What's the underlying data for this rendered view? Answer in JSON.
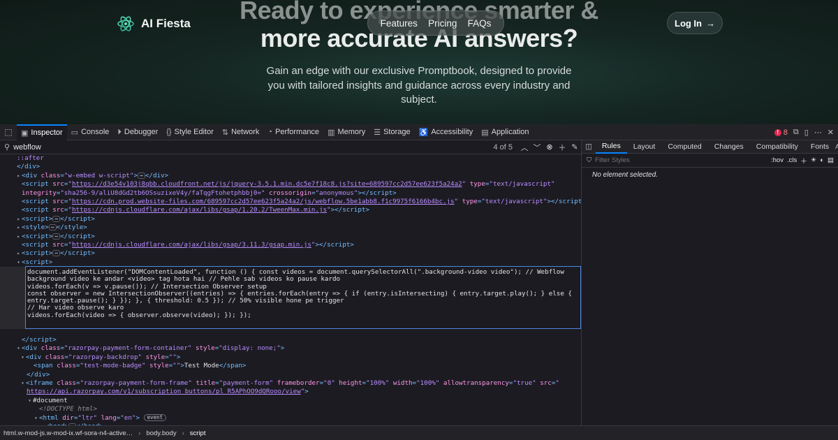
{
  "site": {
    "brand": "AI Fiesta",
    "nav": [
      "Features",
      "Pricing",
      "FAQs"
    ],
    "login_label": "Log In",
    "hero_line1": "Ready to experience smarter &",
    "hero_line2": "more accurate AI answers?",
    "hero_sub": "Gain an edge with our exclusive Promptbook, designed to provide you with tailored insights and guidance across every industry and subject."
  },
  "devtools": {
    "tabs": [
      {
        "label": "Inspector",
        "icon": "inspector-icon"
      },
      {
        "label": "Console",
        "icon": "console-icon"
      },
      {
        "label": "Debugger",
        "icon": "debugger-icon"
      },
      {
        "label": "Style Editor",
        "icon": "style-editor-icon"
      },
      {
        "label": "Network",
        "icon": "network-icon"
      },
      {
        "label": "Performance",
        "icon": "performance-icon"
      },
      {
        "label": "Memory",
        "icon": "memory-icon"
      },
      {
        "label": "Storage",
        "icon": "storage-icon"
      },
      {
        "label": "Accessibility",
        "icon": "accessibility-icon"
      },
      {
        "label": "Application",
        "icon": "application-icon"
      }
    ],
    "error_count": "8",
    "search": {
      "query": "webflow",
      "count": "4 of 5"
    },
    "markup": {
      "after": "::after",
      "close_div": "</div>",
      "embed_class": "w-embed w-script",
      "script1_src": "https://d3e54v103j8qbb.cloudfront.net/js/jquery-3.5.1.min.dc5e7f18c8.js?site=689597cc2d57ee623f5a24a2",
      "script1_type": "text/javascript",
      "script1_integrity": "sha256-9/aliU8dGd2tb6OSsuzixeV4y/faTqgFtohetphbbj0=",
      "script1_crossorigin": "anonymous",
      "script2_src": "https://cdn.prod.website-files.com/689597cc2d57ee623f5a24a2/js/webflow.5be1abb8.f1c9975f6166b4bc.js",
      "script2_type": "text/javascript",
      "script3_src": "https://cdnjs.cloudflare.com/ajax/libs/gsap/1.20.2/TweenMax.min.js",
      "script4_src": "https://cdnjs.cloudflare.com/ajax/libs/gsap/3.11.3/gsap.min.js",
      "script_body": "document.addEventListener(\"DOMContentLoaded\", function () { const videos = document.querySelectorAll(\".background-video video\"); // Webflow background video ke andar <video> tag hota hai // Pehle sab videos ko pause kardo\nvideos.forEach(v => v.pause()); // Intersection Observer setup\nconst observer = new IntersectionObserver((entries) => { entries.forEach(entry => { if (entry.isIntersecting) { entry.target.play(); } else { entry.target.pause(); } }); }, { threshold: 0.5 }); // 50% visible hone pe trigger\n// Har video observe karo\nvideos.forEach(video => { observer.observe(video); }); });",
      "rzp_container_class": "razorpay-payment-form-container",
      "rzp_container_style": "display: none;",
      "rzp_backdrop_class": "razorpay-backdrop",
      "rzp_backdrop_style": "",
      "badge_class": "test-mode-badge",
      "badge_style": "",
      "badge_text": "Test Mode",
      "iframe_class": "razorpay-payment-form-frame",
      "iframe_title": "payment-form",
      "iframe_frameborder": "0",
      "iframe_height": "100%",
      "iframe_width": "100%",
      "iframe_allowtransparency": "true",
      "iframe_src": "https://api.razorpay.com/v1/subscription_buttons/pl_R5APhOO9dQRooo/view",
      "document_label": "#document",
      "doctype": "<!DOCTYPE html>",
      "html_dir": "ltr",
      "html_lang": "en",
      "event_badge": "event"
    },
    "breadcrumbs": [
      "html.w-mod-js.w-mod-ix.wf-sora-n4-active…",
      "body.body",
      "script"
    ],
    "rules_tabs": [
      "Rules",
      "Layout",
      "Computed",
      "Changes",
      "Compatibility",
      "Fonts"
    ],
    "filter_placeholder": "Filter Styles",
    "hov": ":hov",
    "cls": ".cls",
    "no_element": "No element selected."
  }
}
